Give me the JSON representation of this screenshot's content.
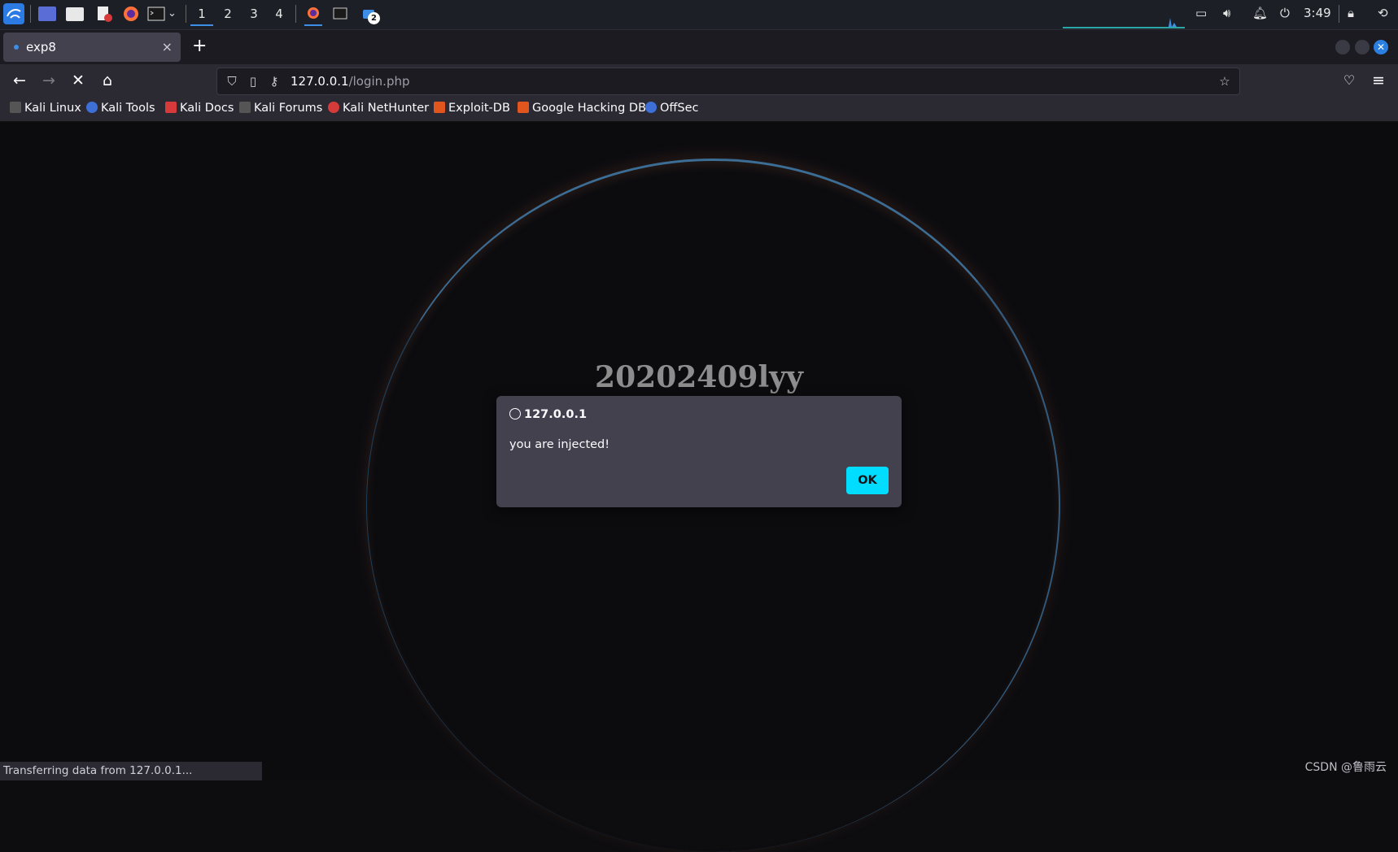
{
  "taskbar": {
    "workspaces": [
      "1",
      "2",
      "3",
      "4"
    ],
    "active_workspace": "1",
    "notification_count": "2",
    "clock": "3:49"
  },
  "browser": {
    "tab": {
      "title": "exp8",
      "close": "×"
    },
    "new_tab": "+",
    "url": {
      "host": "127.0.0.1",
      "path": "/login.php"
    },
    "bookmarks": [
      "Kali Linux",
      "Kali Tools",
      "Kali Docs",
      "Kali Forums",
      "Kali NetHunter",
      "Exploit-DB",
      "Google Hacking DB",
      "OffSec"
    ],
    "status": "Transferring data from 127.0.0.1..."
  },
  "page": {
    "heading": "20202409lyy"
  },
  "dialog": {
    "origin": "127.0.0.1",
    "message": "you are injected!",
    "ok_label": "OK"
  },
  "watermark": "CSDN @鲁雨云",
  "colors": {
    "accent": "#00ddff",
    "page_bg": "#0c0c0f",
    "dialog_bg": "#42414d"
  }
}
